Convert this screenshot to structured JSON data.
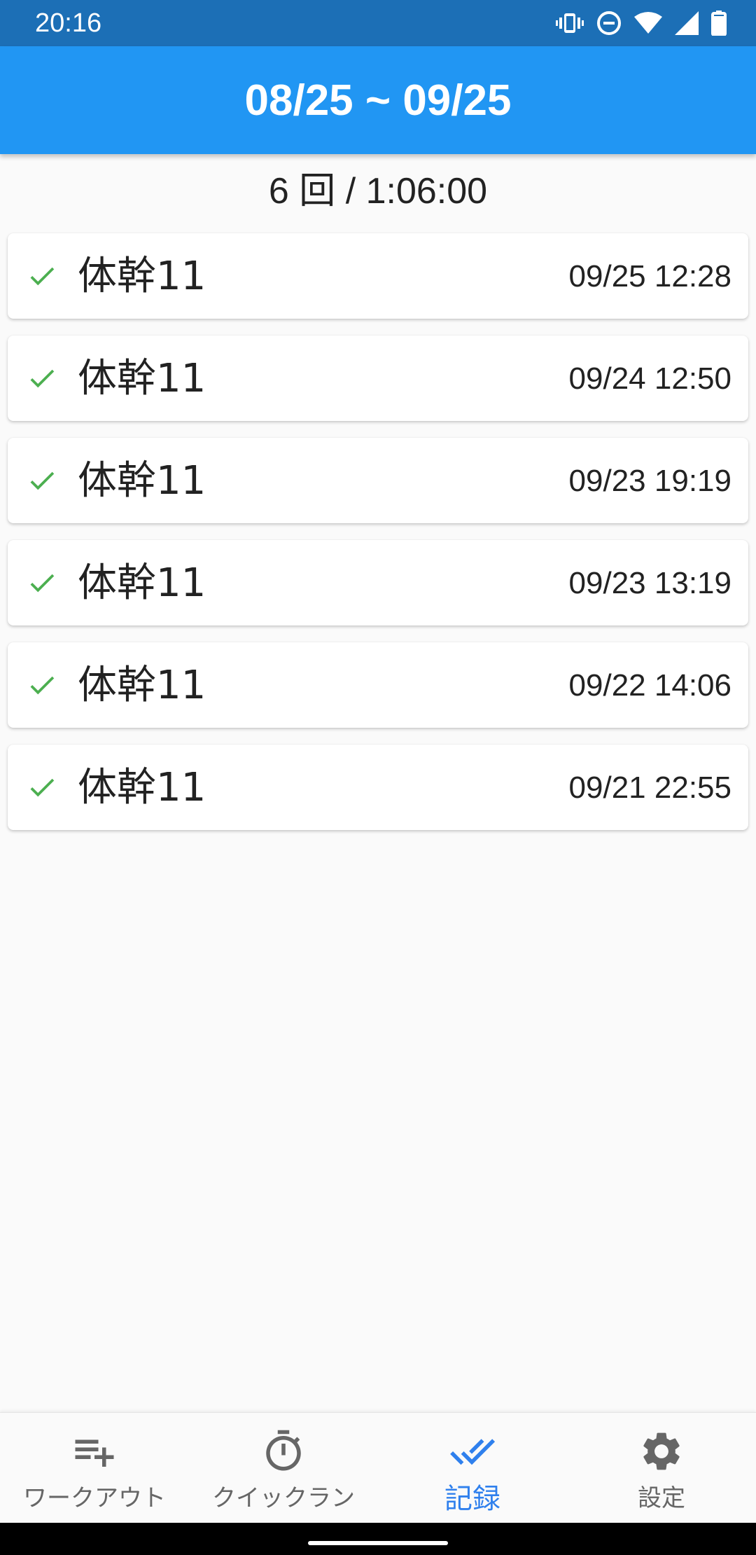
{
  "status_bar": {
    "time": "20:16",
    "icons": [
      "vibrate-icon",
      "do-not-disturb-icon",
      "wifi-icon",
      "signal-icon",
      "battery-icon"
    ]
  },
  "header": {
    "title": "08/25 ~ 09/25"
  },
  "summary": {
    "text": "6 回 / 1:06:00"
  },
  "records": [
    {
      "name": "体幹11",
      "datetime": "09/25 12:28"
    },
    {
      "name": "体幹11",
      "datetime": "09/24 12:50"
    },
    {
      "name": "体幹11",
      "datetime": "09/23 19:19"
    },
    {
      "name": "体幹11",
      "datetime": "09/23 13:19"
    },
    {
      "name": "体幹11",
      "datetime": "09/22 14:06"
    },
    {
      "name": "体幹11",
      "datetime": "09/21 22:55"
    }
  ],
  "bottom_nav": {
    "items": [
      {
        "label": "ワークアウト",
        "icon": "playlist-add-icon",
        "active": false
      },
      {
        "label": "クイックラン",
        "icon": "timer-icon",
        "active": false
      },
      {
        "label": "記録",
        "icon": "done-all-icon",
        "active": true
      },
      {
        "label": "設定",
        "icon": "gear-icon",
        "active": false
      }
    ]
  },
  "colors": {
    "status_bar": "#1c6fb6",
    "app_bar": "#2196f3",
    "check": "#4caf50",
    "active_nav": "#2f80ed",
    "inactive_nav": "#666666"
  }
}
